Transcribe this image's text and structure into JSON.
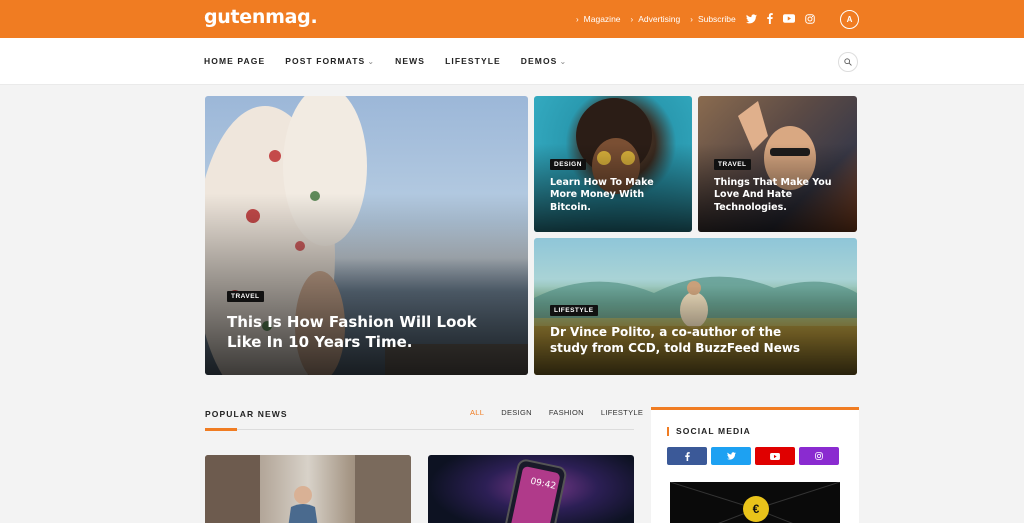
{
  "brand": {
    "logo": "gutenmag.",
    "accent": "#f07c22"
  },
  "topbar": {
    "links": [
      "Magazine",
      "Advertising",
      "Subscribe"
    ],
    "social_icons": [
      "twitter-icon",
      "facebook-icon",
      "youtube-icon",
      "instagram-icon"
    ],
    "badge": "A"
  },
  "nav": {
    "items": [
      "HOME PAGE",
      "POST FORMATS",
      "NEWS",
      "LIFESTYLE",
      "DEMOS"
    ]
  },
  "hero": [
    {
      "tag": "TRAVEL",
      "title": "This Is How Fashion Will Look Like In 10 Years Time."
    },
    {
      "tag": "DESIGN",
      "title": "Learn How To Make More Money With Bitcoin."
    },
    {
      "tag": "TRAVEL",
      "title": "Things That Make You Love And Hate Technologies."
    },
    {
      "tag": "LIFESTYLE",
      "title": "Dr Vince Polito, a co-author of the study from CCD, told BuzzFeed News"
    }
  ],
  "popular": {
    "title": "POPULAR NEWS",
    "tabs": [
      "ALL",
      "DESIGN",
      "FASHION",
      "LIFESTYLE"
    ],
    "phone_time": "09:42"
  },
  "social_widget": {
    "title": "SOCIAL MEDIA",
    "buttons": [
      {
        "icon": "facebook-icon",
        "color": "#3b5998"
      },
      {
        "icon": "twitter-icon",
        "color": "#1da1f2"
      },
      {
        "icon": "youtube-icon",
        "color": "#e00000"
      },
      {
        "icon": "instagram-icon",
        "color": "#8a2bd0"
      }
    ]
  }
}
